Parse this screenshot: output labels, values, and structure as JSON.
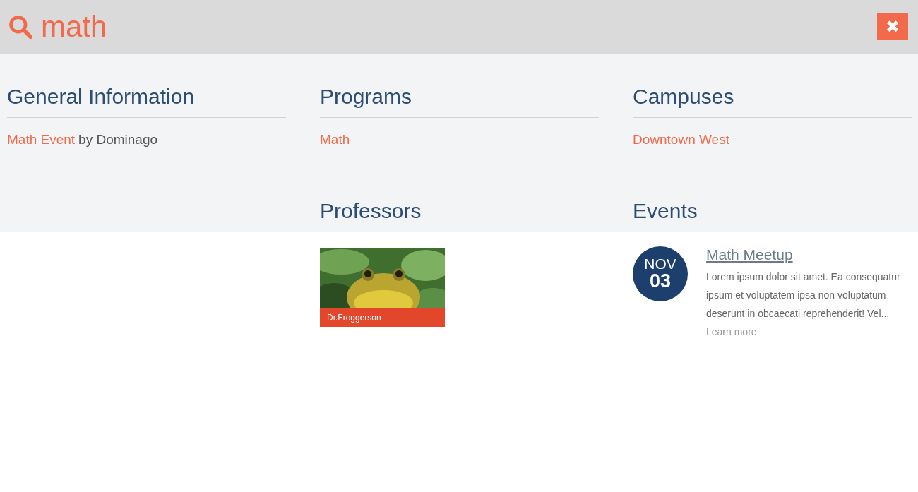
{
  "search": {
    "value": "math"
  },
  "close_button": {
    "label": "✖"
  },
  "sections": [
    {
      "title": "General Information",
      "kind": "links",
      "items": [
        {
          "link": "Math Event",
          "suffix": "by Dominago"
        }
      ]
    },
    {
      "title": "Programs",
      "kind": "links",
      "items": [
        {
          "link": "Math"
        }
      ]
    },
    {
      "title": "Campuses",
      "kind": "links",
      "items": [
        {
          "link": "Downtown West"
        }
      ]
    },
    {
      "title": "Professors",
      "kind": "people",
      "items": [
        {
          "name": "Dr.Froggerson",
          "kind": "picture"
        }
      ]
    },
    {
      "title": "Events",
      "kind": "events",
      "items": [
        {
          "month": "NOV",
          "day": "03",
          "title": "Math Meetup",
          "summary": "Lorem ipsum dolor sit amet. Ea consequatur ipsum et voluptatem ipsa non voluptatum deserunt in obcaecati reprehenderit! Vel...",
          "more": "Learn more"
        }
      ]
    }
  ]
}
